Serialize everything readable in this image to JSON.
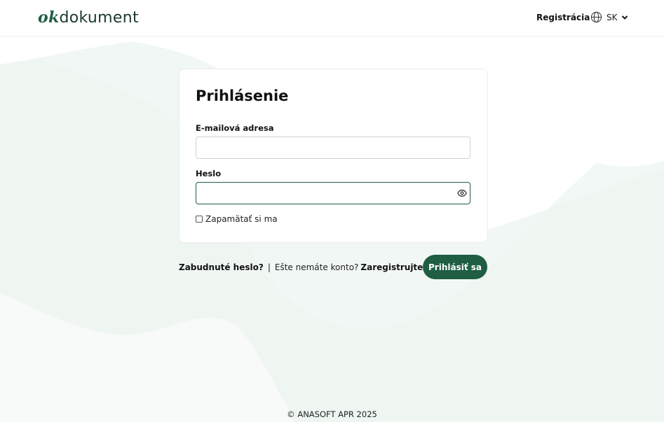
{
  "header": {
    "logo_ok": "ok",
    "logo_rest": "dokument",
    "register_link": "Registrácia",
    "language_code": "SK"
  },
  "login_form": {
    "title": "Prihlásenie",
    "email_label": "E-mailová adresa",
    "email_value": "",
    "password_label": "Heslo",
    "password_value": "",
    "remember_label": "Zapamätať si ma",
    "remember_checked": false
  },
  "links": {
    "forgot_password": "Zabudnuté heslo?",
    "separator": "|",
    "no_account": "Ešte nemáte konto?",
    "register": "Zaregistrujte sa"
  },
  "actions": {
    "login_button": "Prihlásiť sa"
  },
  "footer": {
    "copyright": "© ANASOFT APR 2025"
  },
  "colors": {
    "brand": "#1f5e43",
    "background_wave": "#eef5f1"
  }
}
